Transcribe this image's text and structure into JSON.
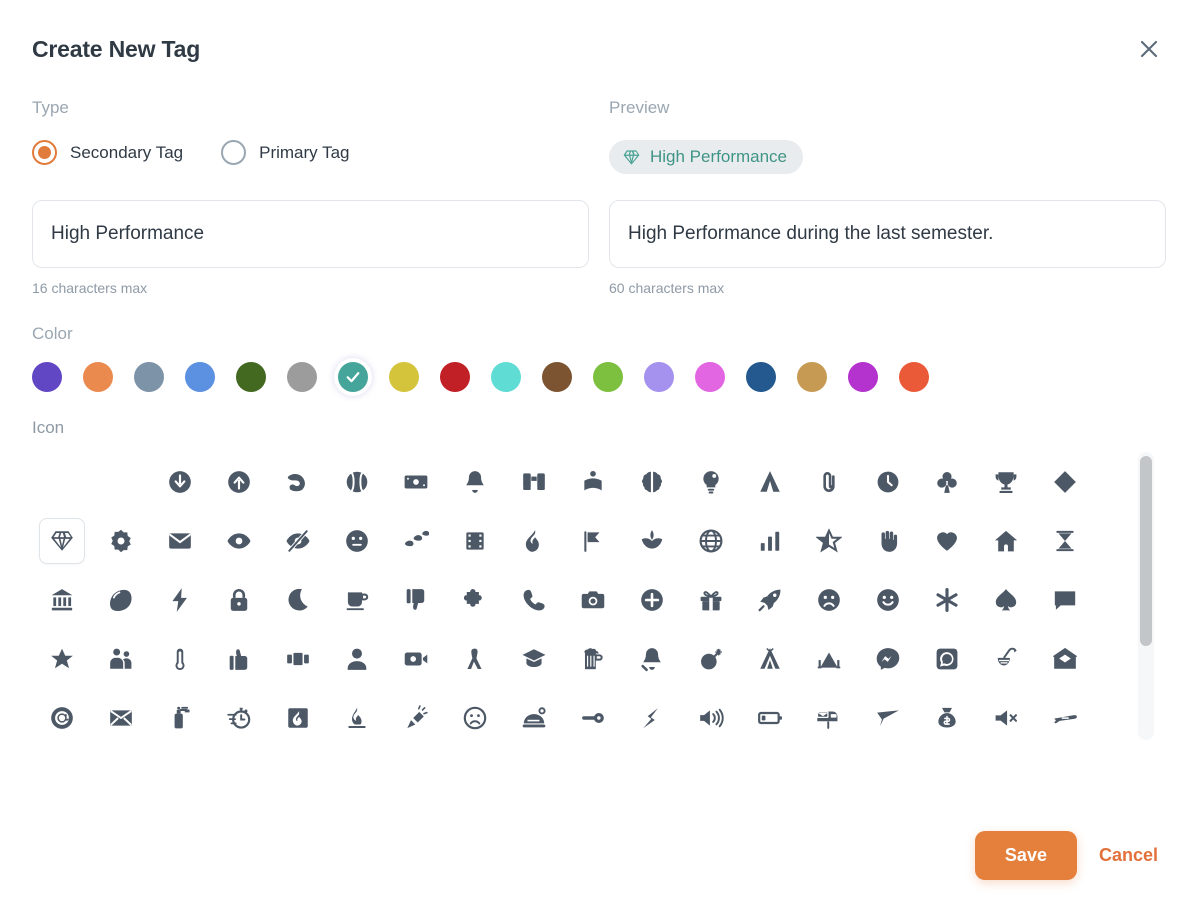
{
  "header": {
    "title": "Create New Tag",
    "close_icon": "close-icon"
  },
  "type_section": {
    "label": "Type",
    "options": [
      {
        "label": "Secondary Tag",
        "value": "secondary",
        "selected": true
      },
      {
        "label": "Primary Tag",
        "value": "primary",
        "selected": false
      }
    ]
  },
  "preview_section": {
    "label": "Preview",
    "pill": {
      "text": "High Performance",
      "icon": "gem-icon",
      "text_color": "#3f9487",
      "icon_color": "#4aa394",
      "background": "#e9ecee"
    }
  },
  "name_field": {
    "value": "High Performance",
    "placeholder": "Tag name",
    "helper": "16 characters max"
  },
  "description_field": {
    "value": "High Performance during the last semester.",
    "placeholder": "Tag description",
    "helper": "60 characters max"
  },
  "color_section": {
    "label": "Color",
    "selected_index": 6,
    "swatches": [
      {
        "hex": "#6247c4",
        "name": "purple"
      },
      {
        "hex": "#ea8a4e",
        "name": "orange"
      },
      {
        "hex": "#7d93a8",
        "name": "slate-blue"
      },
      {
        "hex": "#5b91e0",
        "name": "blue"
      },
      {
        "hex": "#42691f",
        "name": "dark-green"
      },
      {
        "hex": "#9c9c9c",
        "name": "gray"
      },
      {
        "hex": "#45a59a",
        "name": "teal"
      },
      {
        "hex": "#d4c43c",
        "name": "yellow"
      },
      {
        "hex": "#c12026",
        "name": "red"
      },
      {
        "hex": "#5fddd4",
        "name": "turquoise"
      },
      {
        "hex": "#7c5431",
        "name": "brown"
      },
      {
        "hex": "#7dbf3f",
        "name": "light-green"
      },
      {
        "hex": "#a592ee",
        "name": "lavender"
      },
      {
        "hex": "#e266e2",
        "name": "magenta"
      },
      {
        "hex": "#23598f",
        "name": "navy"
      },
      {
        "hex": "#c79a53",
        "name": "tan"
      },
      {
        "hex": "#b432cd",
        "name": "violet"
      },
      {
        "hex": "#ea5a38",
        "name": "tomato"
      }
    ]
  },
  "icon_section": {
    "label": "Icon",
    "selected_icon": "gem-icon",
    "icon_color": "#4d5866",
    "icons": [
      "blank",
      "blank",
      "arrow-circle-down-icon",
      "arrow-circle-up-icon",
      "biceps-icon",
      "baseball-icon",
      "money-bill-icon",
      "bell-icon",
      "binoculars-icon",
      "book-open-reader-icon",
      "brain-icon",
      "lightbulb-icon",
      "tent-icon",
      "paperclip-icon",
      "clock-icon",
      "club-suit-icon",
      "trophy-icon",
      "diamond-icon",
      "gem-icon",
      "gear-icon",
      "envelope-icon",
      "eye-icon",
      "eye-slash-icon",
      "face-meh-icon",
      "shoe-prints-icon",
      "film-icon",
      "fire-flame-icon",
      "flag-pennant-icon",
      "spa-icon",
      "globe-icon",
      "chart-simple-icon",
      "star-half-icon",
      "hand-icon",
      "heart-icon",
      "house-icon",
      "hourglass-icon",
      "bank-icon",
      "lemon-icon",
      "bolt-icon",
      "lock-icon",
      "moon-icon",
      "mug-icon",
      "thumbs-down-icon",
      "puzzle-piece-icon",
      "phone-icon",
      "camera-icon",
      "circle-plus-icon",
      "gift-icon",
      "rocket-icon",
      "face-frown-icon",
      "face-smile-icon",
      "asterisk-icon",
      "spade-suit-icon",
      "comment-icon",
      "star-icon",
      "user-group-icon",
      "thermometer-icon",
      "thumbs-up-icon",
      "ticket-icon",
      "user-icon",
      "video-icon",
      "person-walking-icon",
      "graduation-cap-icon",
      "beer-mug-icon",
      "bell-slash-icon",
      "bomb-icon",
      "teepee-icon",
      "tent-camp-icon",
      "messenger-icon",
      "whatsapp-icon",
      "cocktail-icon",
      "envelope-open-icon",
      "at-icon",
      "envelope-closed-icon",
      "fire-extinguisher-icon",
      "stopwatch-icon",
      "fire-square-icon",
      "campfire-icon",
      "flashlight-icon",
      "face-sad-icon",
      "bell-concierge-icon",
      "key-icon",
      "bolt-lightning-icon",
      "volume-high-icon",
      "battery-low-icon",
      "mailbox-icon",
      "paper-plane-icon",
      "money-bag-icon",
      "volume-xmark-icon",
      "plane-icon",
      "router-icon"
    ]
  },
  "footer": {
    "save_label": "Save",
    "cancel_label": "Cancel",
    "save_color": "#e57f3c",
    "cancel_color": "#e2703a"
  }
}
